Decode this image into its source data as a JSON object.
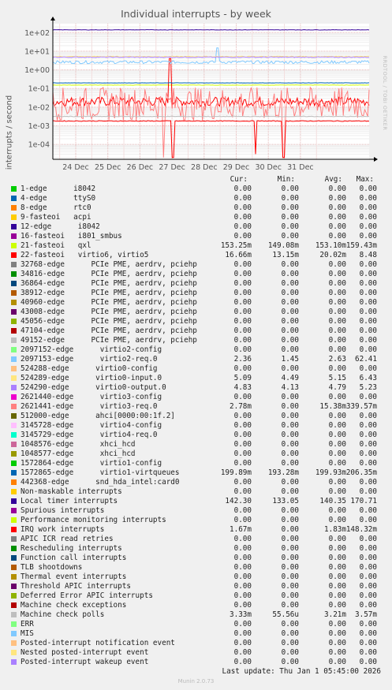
{
  "title": "Individual interrupts - by week",
  "side_label": "RRDTOOL / TOBI OETIKER",
  "footer": {
    "last_update": "Last update:  Thu Jan  1 05:45:00 2026",
    "munin_version": "Munin 2.0.73"
  },
  "legend_header": {
    "cur": "Cur:",
    "min": "Min:",
    "avg": "Avg:",
    "max": "Max:"
  },
  "chart_data": {
    "type": "line",
    "title": "Individual interrupts - by week",
    "ylabel": "interrupts / second",
    "xlabel": "",
    "y_scale": "log",
    "ylim": [
      1.6e-05,
      300
    ],
    "y_ticks": [
      {
        "value": 100,
        "label": "1e+02"
      },
      {
        "value": 10,
        "label": "1e+01"
      },
      {
        "value": 1,
        "label": "1e+00"
      },
      {
        "value": 0.1,
        "label": "1e-01"
      },
      {
        "value": 0.01,
        "label": "1e-02"
      },
      {
        "value": 0.001,
        "label": "1e-03"
      },
      {
        "value": 0.0001,
        "label": "1e-04"
      }
    ],
    "x_ticks": [
      "24 Dec",
      "25 Dec",
      "26 Dec",
      "27 Dec",
      "28 Dec",
      "29 Dec",
      "30 Dec",
      "31 Dec"
    ],
    "grid": true,
    "legend_position": "bottom",
    "series": [
      {
        "name": "1-edge      i8042",
        "color": "#00cc00",
        "cur": "0.00",
        "min": "0.00",
        "avg": "0.00",
        "max": "0.00",
        "level": 0
      },
      {
        "name": "4-edge      ttyS0",
        "color": "#0066b3",
        "cur": "0.00",
        "min": "0.00",
        "avg": "0.00",
        "max": "0.00",
        "level": 0
      },
      {
        "name": "8-edge      rtc0",
        "color": "#ff8000",
        "cur": "0.00",
        "min": "0.00",
        "avg": "0.00",
        "max": "0.00",
        "level": 0
      },
      {
        "name": "9-fasteoi   acpi",
        "color": "#ffcc00",
        "cur": "0.00",
        "min": "0.00",
        "avg": "0.00",
        "max": "0.00",
        "level": 0
      },
      {
        "name": "12-edge      i8042",
        "color": "#330099",
        "cur": "0.00",
        "min": "0.00",
        "avg": "0.00",
        "max": "0.00",
        "level": 0
      },
      {
        "name": "16-fasteoi   i801_smbus",
        "color": "#990099",
        "cur": "0.00",
        "min": "0.00",
        "avg": "0.00",
        "max": "0.00",
        "level": 0
      },
      {
        "name": "21-fasteoi   qxl",
        "color": "#ccff00",
        "cur": "153.25m",
        "min": "149.08m",
        "avg": "153.10m",
        "max": "159.43m",
        "level": 0.153
      },
      {
        "name": "22-fasteoi   virtio6, virtio5",
        "color": "#ff0000",
        "cur": "16.66m",
        "min": "13.15m",
        "avg": "20.02m",
        "max": "8.48",
        "level": 0.02
      },
      {
        "name": "32768-edge      PCIe PME, aerdrv, pciehp",
        "color": "#808080",
        "cur": "0.00",
        "min": "0.00",
        "avg": "0.00",
        "max": "0.00",
        "level": 0
      },
      {
        "name": "34816-edge      PCIe PME, aerdrv, pciehp",
        "color": "#008f00",
        "cur": "0.00",
        "min": "0.00",
        "avg": "0.00",
        "max": "0.00",
        "level": 0
      },
      {
        "name": "36864-edge      PCIe PME, aerdrv, pciehp",
        "color": "#00487d",
        "cur": "0.00",
        "min": "0.00",
        "avg": "0.00",
        "max": "0.00",
        "level": 0
      },
      {
        "name": "38912-edge      PCIe PME, aerdrv, pciehp",
        "color": "#b35a00",
        "cur": "0.00",
        "min": "0.00",
        "avg": "0.00",
        "max": "0.00",
        "level": 0
      },
      {
        "name": "40960-edge      PCIe PME, aerdrv, pciehp",
        "color": "#b38f00",
        "cur": "0.00",
        "min": "0.00",
        "avg": "0.00",
        "max": "0.00",
        "level": 0
      },
      {
        "name": "43008-edge      PCIe PME, aerdrv, pciehp",
        "color": "#6b006b",
        "cur": "0.00",
        "min": "0.00",
        "avg": "0.00",
        "max": "0.00",
        "level": 0
      },
      {
        "name": "45056-edge      PCIe PME, aerdrv, pciehp",
        "color": "#8fb300",
        "cur": "0.00",
        "min": "0.00",
        "avg": "0.00",
        "max": "0.00",
        "level": 0
      },
      {
        "name": "47104-edge      PCIe PME, aerdrv, pciehp",
        "color": "#b30000",
        "cur": "0.00",
        "min": "0.00",
        "avg": "0.00",
        "max": "0.00",
        "level": 0
      },
      {
        "name": "49152-edge      PCIe PME, aerdrv, pciehp",
        "color": "#bebebe",
        "cur": "0.00",
        "min": "0.00",
        "avg": "0.00",
        "max": "0.00",
        "level": 0
      },
      {
        "name": "2097152-edge      virtio2-config",
        "color": "#80ff80",
        "cur": "0.00",
        "min": "0.00",
        "avg": "0.00",
        "max": "0.00",
        "level": 0
      },
      {
        "name": "2097153-edge      virtio2-req.0",
        "color": "#80c9ff",
        "cur": "2.36",
        "min": "1.45",
        "avg": "2.63",
        "max": "62.41",
        "level": 2.6
      },
      {
        "name": "524288-edge      virtio0-config",
        "color": "#ffc080",
        "cur": "0.00",
        "min": "0.00",
        "avg": "0.00",
        "max": "0.00",
        "level": 0
      },
      {
        "name": "524289-edge      virtio0-input.0",
        "color": "#ffe680",
        "cur": "5.09",
        "min": "4.49",
        "avg": "5.15",
        "max": "6.43",
        "level": 5.15
      },
      {
        "name": "524290-edge      virtio0-output.0",
        "color": "#aa80ff",
        "cur": "4.83",
        "min": "4.13",
        "avg": "4.79",
        "max": "5.23",
        "level": 4.79
      },
      {
        "name": "2621440-edge      virtio3-config",
        "color": "#ee00cc",
        "cur": "0.00",
        "min": "0.00",
        "avg": "0.00",
        "max": "0.00",
        "level": 0
      },
      {
        "name": "2621441-edge      virtio3-req.0",
        "color": "#ff8080",
        "cur": "2.78m",
        "min": "0.00",
        "avg": "15.38m",
        "max": "339.57m",
        "level": 0.015
      },
      {
        "name": "512000-edge      ahci[0000:00:1f.2]",
        "color": "#666600",
        "cur": "0.00",
        "min": "0.00",
        "avg": "0.00",
        "max": "0.00",
        "level": 0
      },
      {
        "name": "3145728-edge      virtio4-config",
        "color": "#ffbfff",
        "cur": "0.00",
        "min": "0.00",
        "avg": "0.00",
        "max": "0.00",
        "level": 0
      },
      {
        "name": "3145729-edge      virtio4-req.0",
        "color": "#00ffcc",
        "cur": "0.00",
        "min": "0.00",
        "avg": "0.00",
        "max": "0.00",
        "level": 0
      },
      {
        "name": "1048576-edge      xhci_hcd",
        "color": "#cc6699",
        "cur": "0.00",
        "min": "0.00",
        "avg": "0.00",
        "max": "0.00",
        "level": 0
      },
      {
        "name": "1048577-edge      xhci_hcd",
        "color": "#999900",
        "cur": "0.00",
        "min": "0.00",
        "avg": "0.00",
        "max": "0.00",
        "level": 0
      },
      {
        "name": "1572864-edge      virtio1-config",
        "color": "#00cc00",
        "cur": "0.00",
        "min": "0.00",
        "avg": "0.00",
        "max": "0.00",
        "level": 0
      },
      {
        "name": "1572865-edge      virtio1-virtqueues",
        "color": "#0066b3",
        "cur": "199.89m",
        "min": "193.28m",
        "avg": "199.93m",
        "max": "206.35m",
        "level": 0.2
      },
      {
        "name": "442368-edge      snd_hda_intel:card0",
        "color": "#ff8000",
        "cur": "0.00",
        "min": "0.00",
        "avg": "0.00",
        "max": "0.00",
        "level": 0
      },
      {
        "name": "Non-maskable interrupts",
        "color": "#ffcc00",
        "cur": "0.00",
        "min": "0.00",
        "avg": "0.00",
        "max": "0.00",
        "level": 0
      },
      {
        "name": "Local timer interrupts",
        "color": "#330099",
        "cur": "142.30",
        "min": "133.05",
        "avg": "140.35",
        "max": "170.71",
        "level": 140
      },
      {
        "name": "Spurious interrupts",
        "color": "#990099",
        "cur": "0.00",
        "min": "0.00",
        "avg": "0.00",
        "max": "0.00",
        "level": 0
      },
      {
        "name": "Performance monitoring interrupts",
        "color": "#ccff00",
        "cur": "0.00",
        "min": "0.00",
        "avg": "0.00",
        "max": "0.00",
        "level": 0
      },
      {
        "name": "IRQ work interrupts",
        "color": "#ff0000",
        "cur": "1.67m",
        "min": "0.00",
        "avg": "1.83m",
        "max": "148.32m",
        "level": 0.0018
      },
      {
        "name": "APIC ICR read retries",
        "color": "#808080",
        "cur": "0.00",
        "min": "0.00",
        "avg": "0.00",
        "max": "0.00",
        "level": 0
      },
      {
        "name": "Rescheduling interrupts",
        "color": "#008f00",
        "cur": "0.00",
        "min": "0.00",
        "avg": "0.00",
        "max": "0.00",
        "level": 0
      },
      {
        "name": "Function call interrupts",
        "color": "#00487d",
        "cur": "0.00",
        "min": "0.00",
        "avg": "0.00",
        "max": "0.00",
        "level": 0
      },
      {
        "name": "TLB shootdowns",
        "color": "#b35a00",
        "cur": "0.00",
        "min": "0.00",
        "avg": "0.00",
        "max": "0.00",
        "level": 0
      },
      {
        "name": "Thermal event interrupts",
        "color": "#b38f00",
        "cur": "0.00",
        "min": "0.00",
        "avg": "0.00",
        "max": "0.00",
        "level": 0
      },
      {
        "name": "Threshold APIC interrupts",
        "color": "#6b006b",
        "cur": "0.00",
        "min": "0.00",
        "avg": "0.00",
        "max": "0.00",
        "level": 0
      },
      {
        "name": "Deferred Error APIC interrupts",
        "color": "#8fb300",
        "cur": "0.00",
        "min": "0.00",
        "avg": "0.00",
        "max": "0.00",
        "level": 0
      },
      {
        "name": "Machine check exceptions",
        "color": "#b30000",
        "cur": "0.00",
        "min": "0.00",
        "avg": "0.00",
        "max": "0.00",
        "level": 0
      },
      {
        "name": "Machine check polls",
        "color": "#bebebe",
        "cur": "3.33m",
        "min": "55.56u",
        "avg": "3.21m",
        "max": "3.57m",
        "level": 0.0032
      },
      {
        "name": "ERR",
        "color": "#80ff80",
        "cur": "0.00",
        "min": "0.00",
        "avg": "0.00",
        "max": "0.00",
        "level": 0
      },
      {
        "name": "MIS",
        "color": "#80c9ff",
        "cur": "0.00",
        "min": "0.00",
        "avg": "0.00",
        "max": "0.00",
        "level": 0
      },
      {
        "name": "Posted-interrupt notification event",
        "color": "#ffc080",
        "cur": "0.00",
        "min": "0.00",
        "avg": "0.00",
        "max": "0.00",
        "level": 0
      },
      {
        "name": "Nested posted-interrupt event",
        "color": "#ffe680",
        "cur": "0.00",
        "min": "0.00",
        "avg": "0.00",
        "max": "0.00",
        "level": 0
      },
      {
        "name": "Posted-interrupt wakeup event",
        "color": "#aa80ff",
        "cur": "0.00",
        "min": "0.00",
        "avg": "0.00",
        "max": "0.00",
        "level": 0
      }
    ]
  }
}
